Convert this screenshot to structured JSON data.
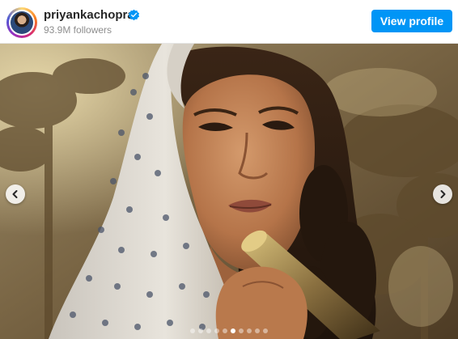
{
  "header": {
    "username": "priyankachopra",
    "followers": "93.9M followers",
    "view_profile_label": "View profile",
    "verified_icon": "verified-badge-icon",
    "accent_color": "#0095f6"
  },
  "carousel": {
    "slide_count": 10,
    "active_index": 5,
    "prev_icon": "chevron-left-icon",
    "next_icon": "chevron-right-icon"
  }
}
